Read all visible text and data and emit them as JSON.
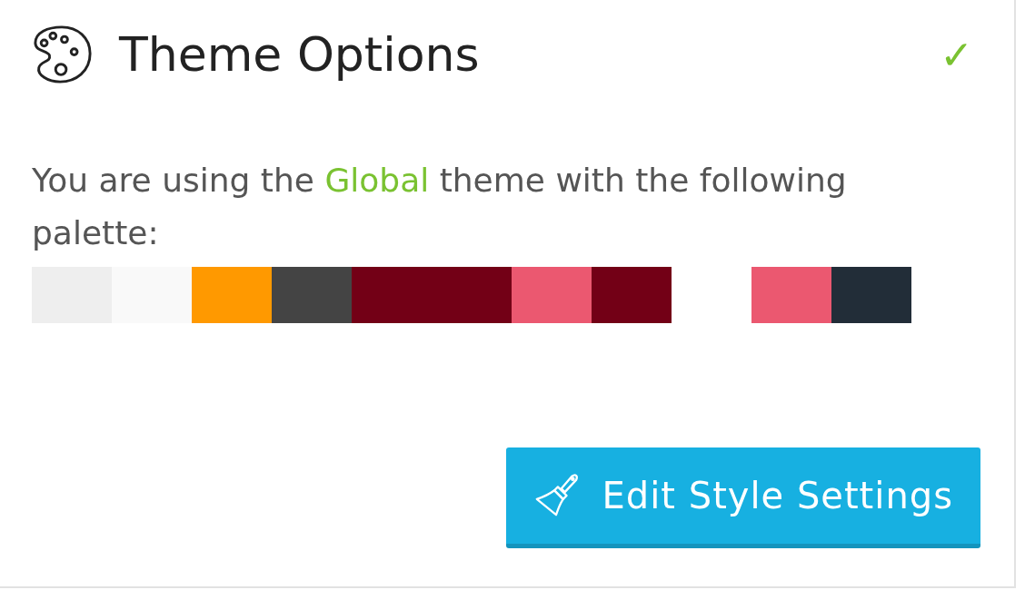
{
  "panel": {
    "title": "Theme Options",
    "status": "✓"
  },
  "message": {
    "before": "You are using the ",
    "theme": "Global",
    "after": " theme with the following palette:"
  },
  "palette": [
    {
      "kind": "swatch",
      "color": "#eeeeee"
    },
    {
      "kind": "swatch",
      "color": "#f9f9f9"
    },
    {
      "kind": "swatch",
      "color": "#ff9900"
    },
    {
      "kind": "swatch",
      "color": "#444444"
    },
    {
      "kind": "swatch",
      "color": "#730016"
    },
    {
      "kind": "swatch",
      "color": "#730016"
    },
    {
      "kind": "swatch",
      "color": "#eb5870"
    },
    {
      "kind": "swatch",
      "color": "#730016"
    },
    {
      "kind": "gap"
    },
    {
      "kind": "swatch",
      "color": "#eb5870"
    },
    {
      "kind": "swatch",
      "color": "#222d38"
    }
  ],
  "button": {
    "label": "Edit Style Settings"
  }
}
